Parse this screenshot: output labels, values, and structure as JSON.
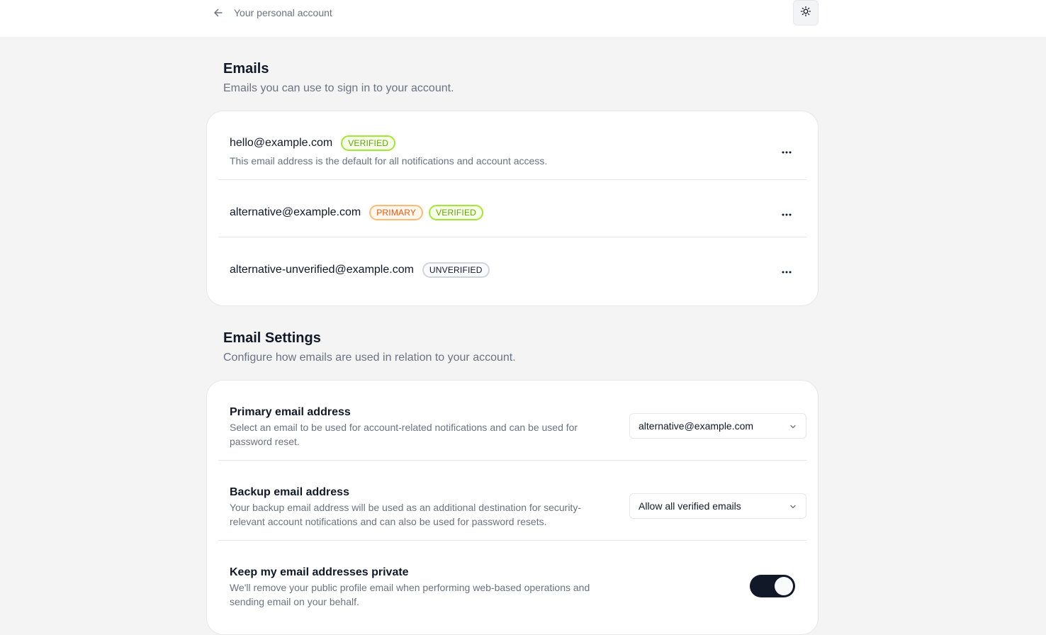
{
  "header": {
    "back_label": "Your personal account",
    "back_icon": "arrow-left-icon",
    "theme_icon": "sun-icon"
  },
  "emails_section": {
    "title": "Emails",
    "subtitle": "Emails you can use to sign in to your account.",
    "items": [
      {
        "address": "hello@example.com",
        "badges": [
          "VERIFIED"
        ],
        "description": "This email address is the default for all notifications and account access."
      },
      {
        "address": "alternative@example.com",
        "badges": [
          "PRIMARY",
          "VERIFIED"
        ],
        "description": ""
      },
      {
        "address": "alternative-unverified@example.com",
        "badges": [
          "UNVERIFIED"
        ],
        "description": ""
      }
    ]
  },
  "settings_section": {
    "title": "Email Settings",
    "subtitle": "Configure how emails are used in relation to your account.",
    "primary": {
      "title": "Primary email address",
      "description": "Select an email to be used for account-related notifications and can be used for password reset.",
      "selected": "alternative@example.com"
    },
    "backup": {
      "title": "Backup email address",
      "description": "Your backup email address will be used as an additional destination for security-relevant account notifications and can also be used for password resets.",
      "selected": "Allow all verified emails"
    },
    "private": {
      "title": "Keep my email addresses private",
      "description": "We'll remove your public profile email when performing web-based operations and sending email on your behalf.",
      "enabled": true
    }
  },
  "colors": {
    "verified": "#65a30d",
    "primary": "#ea580c",
    "toggle_on": "#111827"
  }
}
